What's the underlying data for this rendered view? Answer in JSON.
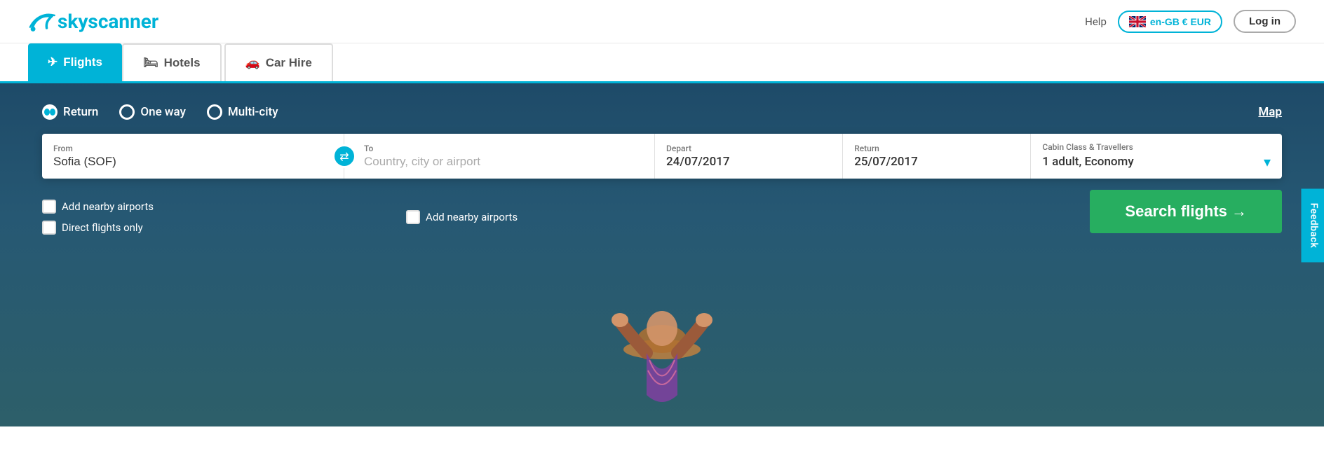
{
  "header": {
    "logo_text": "skyscanner",
    "help_label": "Help",
    "locale_btn": "en-GB € EUR",
    "login_label": "Log in"
  },
  "tabs": [
    {
      "id": "flights",
      "label": "Flights",
      "icon": "✈",
      "active": true
    },
    {
      "id": "hotels",
      "label": "Hotels",
      "icon": "🛏",
      "active": false
    },
    {
      "id": "car-hire",
      "label": "Car Hire",
      "icon": "🚗",
      "active": false
    }
  ],
  "search": {
    "trip_types": [
      {
        "id": "return",
        "label": "Return",
        "selected": true
      },
      {
        "id": "one-way",
        "label": "One way",
        "selected": false
      },
      {
        "id": "multi-city",
        "label": "Multi-city",
        "selected": false
      }
    ],
    "map_label": "Map",
    "from_label": "From",
    "from_value": "Sofia (SOF)",
    "to_label": "To",
    "to_placeholder": "Country, city or airport",
    "depart_label": "Depart",
    "depart_value": "24/07/2017",
    "return_label": "Return",
    "return_value": "25/07/2017",
    "cabin_label": "Cabin Class & Travellers",
    "cabin_value": "1 adult, Economy",
    "add_nearby_from": "Add nearby airports",
    "add_nearby_to": "Add nearby airports",
    "direct_flights": "Direct flights only",
    "search_btn": "Search flights →"
  },
  "feedback": {
    "label": "Feedback"
  }
}
